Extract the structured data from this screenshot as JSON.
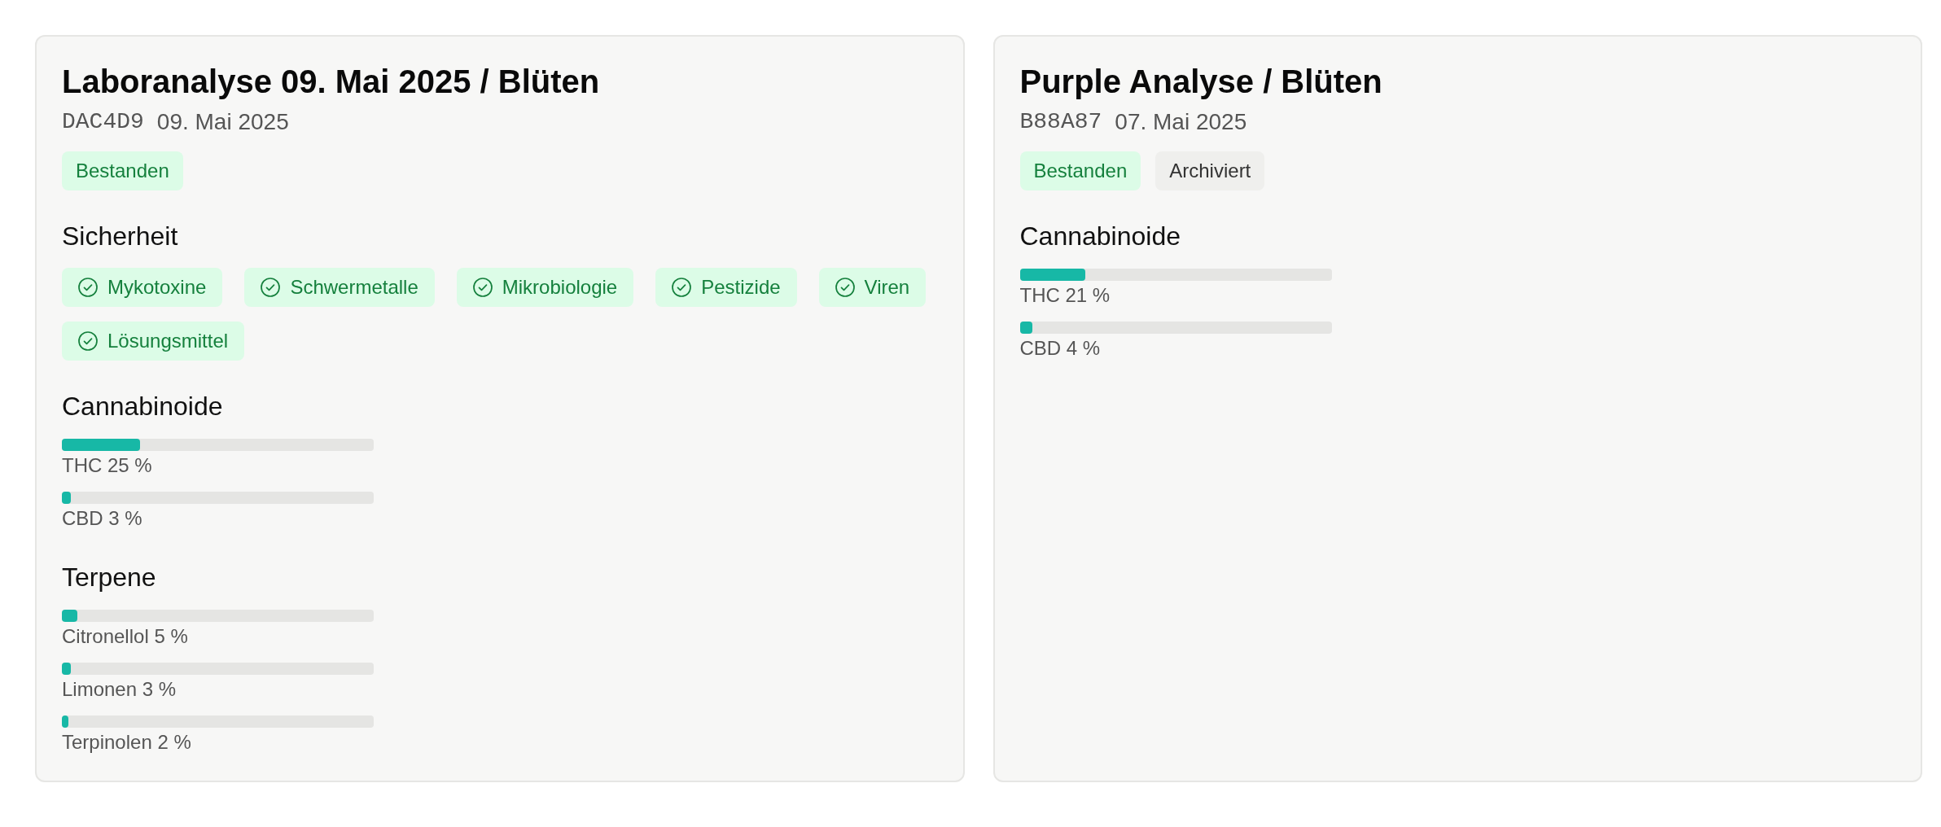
{
  "cards": [
    {
      "title": "Laboranalyse 09. Mai 2025 / Blüten",
      "code": "DAC4D9",
      "date": "09. Mai 2025",
      "badges": [
        {
          "label": "Bestanden",
          "kind": "success"
        }
      ],
      "sections": [
        {
          "heading": "Sicherheit",
          "kind": "checks",
          "items": [
            {
              "label": "Mykotoxine",
              "passed": true
            },
            {
              "label": "Schwermetalle",
              "passed": true
            },
            {
              "label": "Mikrobiologie",
              "passed": true
            },
            {
              "label": "Pestizide",
              "passed": true
            },
            {
              "label": "Viren",
              "passed": true
            },
            {
              "label": "Lösungsmittel",
              "passed": true
            }
          ]
        },
        {
          "heading": "Cannabinoide",
          "kind": "bars",
          "items": [
            {
              "label": "THC 25 %",
              "level": 0.25
            },
            {
              "label": "CBD 3 %",
              "level": 0.03
            }
          ]
        },
        {
          "heading": "Terpene",
          "kind": "bars",
          "items": [
            {
              "label": "Citronellol 5 %",
              "level": 0.05
            },
            {
              "label": "Limonen 3 %",
              "level": 0.03
            },
            {
              "label": "Terpinolen 2 %",
              "level": 0.02
            }
          ]
        }
      ]
    },
    {
      "title": "Purple Analyse / Blüten",
      "code": "B88A87",
      "date": "07. Mai 2025",
      "badges": [
        {
          "label": "Bestanden",
          "kind": "success"
        },
        {
          "label": "Archiviert",
          "kind": "neutral"
        }
      ],
      "sections": [
        {
          "heading": "Cannabinoide",
          "kind": "bars",
          "items": [
            {
              "label": "THC 21 %",
              "level": 0.21
            },
            {
              "label": "CBD 4 %",
              "level": 0.04
            }
          ]
        }
      ]
    }
  ]
}
